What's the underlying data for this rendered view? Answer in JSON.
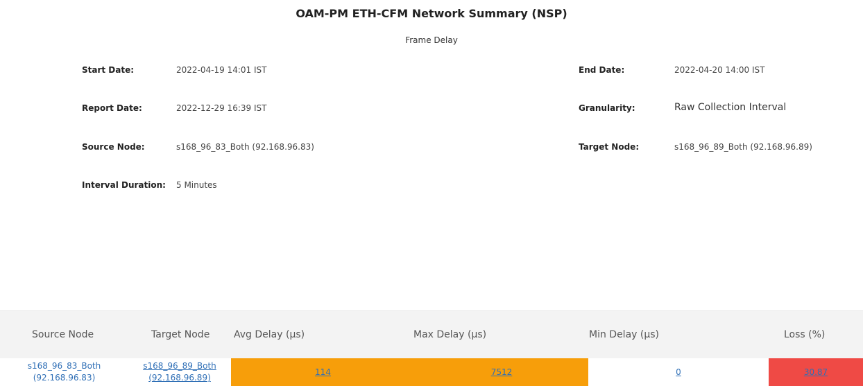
{
  "report": {
    "title": "OAM-PM ETH-CFM Network Summary (NSP)",
    "subtitle": "Frame Delay"
  },
  "meta": {
    "start_date_label": "Start Date:",
    "start_date": "2022-04-19 14:01 IST",
    "end_date_label": "End Date:",
    "end_date": "2022-04-20 14:00 IST",
    "report_date_label": "Report Date:",
    "report_date": "2022-12-29 16:39 IST",
    "granularity_label": "Granularity:",
    "granularity": "Raw Collection Interval",
    "source_node_label": "Source Node:",
    "source_node": "s168_96_83_Both (92.168.96.83)",
    "target_node_label": "Target Node:",
    "target_node": "s168_96_89_Both (92.168.96.89)",
    "interval_duration_label": "Interval Duration:",
    "interval_duration": "5 Minutes"
  },
  "table": {
    "headers": [
      "Source Node",
      "Target Node",
      "Avg Delay (μs)",
      "Max Delay (μs)",
      "Min Delay (μs)",
      "Loss (%)"
    ],
    "rows": [
      {
        "source_name": "s168_96_83_Both",
        "source_ip": "(92.168.96.83)",
        "target_name": "s168_96_89_Both",
        "target_ip": "(92.168.96.89)",
        "avg_delay": "114",
        "max_delay": "7512",
        "min_delay": "0",
        "loss": "30.87"
      }
    ]
  },
  "colors": {
    "delay_warning": "#f79e0a",
    "loss_critical": "#ef4a45",
    "link": "#2f6fb6"
  }
}
